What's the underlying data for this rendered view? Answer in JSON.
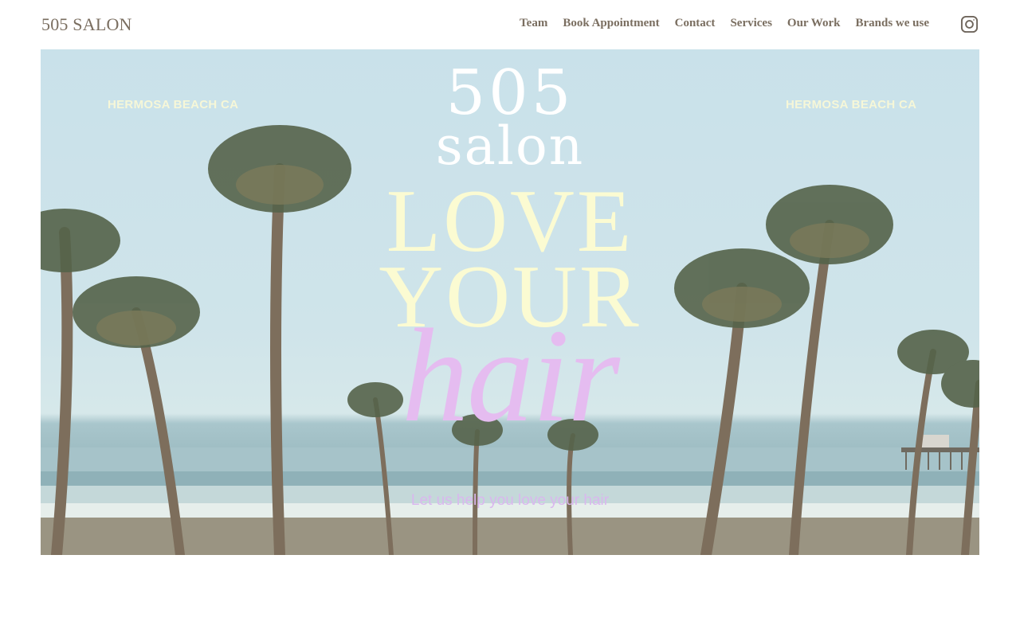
{
  "header": {
    "brand": "505 SALON",
    "nav": [
      "Team",
      "Book Appointment",
      "Contact",
      "Services",
      "Our Work",
      "Brands we use"
    ],
    "instagram_icon": "instagram-icon"
  },
  "hero": {
    "location_left": "HERMOSA BEACH CA",
    "location_right": "HERMOSA BEACH CA",
    "line_505": "505",
    "line_salon": "salon",
    "line_love": "LOVE",
    "line_your": "YOUR",
    "line_hair": "hair",
    "tagline": "Let us help you love your hair"
  },
  "colors": {
    "nav_text": "#7a6e60",
    "love_your": "#fbfbd2",
    "hair_script": "#e5bcf0",
    "tagline": "#d9b7ee",
    "sky": "#c9e1ea"
  }
}
